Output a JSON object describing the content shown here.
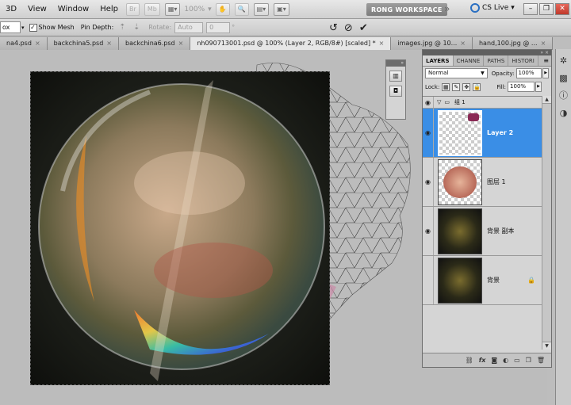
{
  "menu": {
    "items": [
      "3D",
      "View",
      "Window",
      "Help"
    ],
    "zoom": "100%",
    "workspace": "RONG WORKSPACE",
    "cslive": "CS Live"
  },
  "options": {
    "mode_value": "ox",
    "show_mesh_label": "Show Mesh",
    "show_mesh_checked": "✓",
    "pin_depth_label": "Pin Depth:",
    "rotate_label": "Rotate:",
    "rotate_value": "Auto",
    "angle_value": "0",
    "angle_unit": "°"
  },
  "tabs": [
    {
      "label": "na4.psd",
      "active": false
    },
    {
      "label": "backchina5.psd",
      "active": false
    },
    {
      "label": "backchina6.psd",
      "active": false
    },
    {
      "label": "nh090713001.psd @ 100% (Layer 2, RGB/8#) [scaled] *",
      "active": true
    },
    {
      "label": "images.jpg @ 10...",
      "active": false
    },
    {
      "label": "hand,100.jpg @ ...",
      "active": false
    }
  ],
  "layers_panel": {
    "tabs": [
      "LAYERS",
      "CHANNE",
      "PATHS",
      "HISTORI"
    ],
    "blend_mode": "Normal",
    "opacity_label": "Opacity:",
    "opacity_value": "100%",
    "lock_label": "Lock:",
    "fill_label": "Fill:",
    "fill_value": "100%",
    "group_name": "组 1",
    "layers": [
      {
        "name": "Layer 2",
        "selected": true,
        "visible": true
      },
      {
        "name": "图层 1",
        "selected": false,
        "visible": true
      },
      {
        "name": "背景 副本",
        "selected": false,
        "visible": true
      },
      {
        "name": "背景",
        "selected": false,
        "visible": false,
        "locked": true
      }
    ]
  },
  "colors": {
    "selection_blue": "#3a8ee6",
    "workspace_grey": "#8a8a8a",
    "cslive_blue": "#2a6fc2",
    "close_red": "#c0392b"
  },
  "icons": [
    "rotate-icon",
    "cancel-icon",
    "commit-check-icon",
    "eye-icon",
    "folder-icon",
    "lock-icon",
    "link-icon",
    "fx-icon",
    "mask-icon",
    "adjustment-icon",
    "new-group-icon",
    "new-layer-icon",
    "trash-icon"
  ]
}
